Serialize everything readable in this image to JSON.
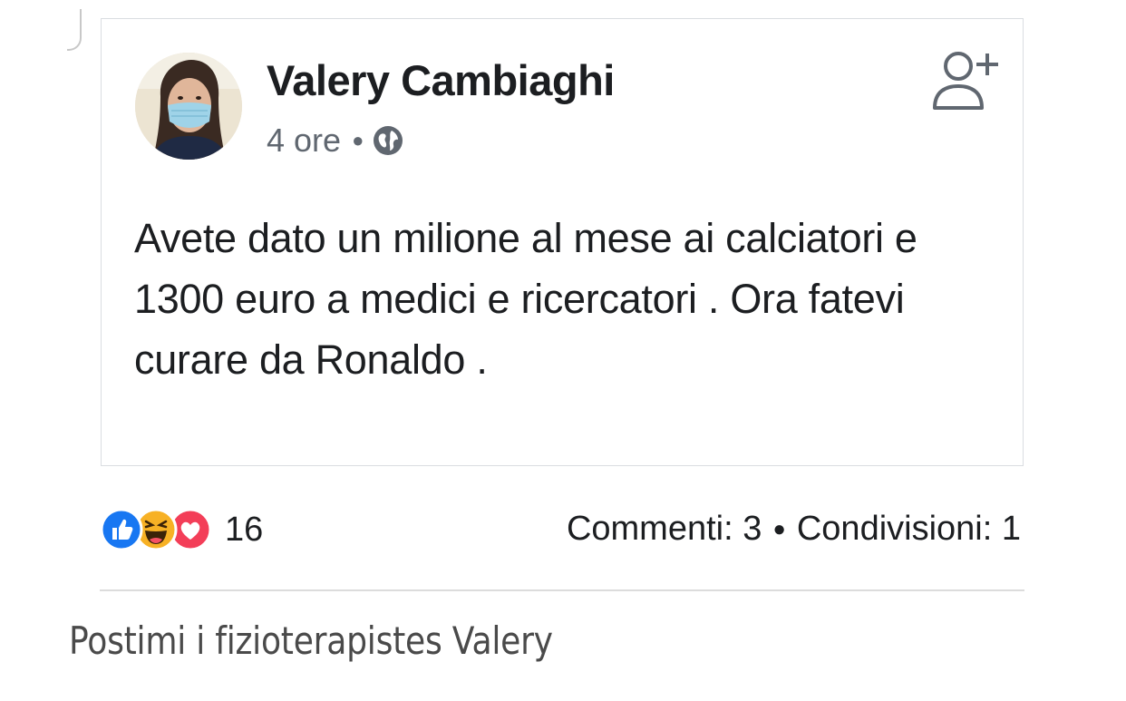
{
  "post": {
    "author": "Valery Cambiaghi",
    "time": "4 ore",
    "privacy_icon": "globe-icon",
    "text": "Avete dato un milione al mese ai calciatori e 1300 euro a medici e ricercatori . Ora fatevi curare da Ronaldo .",
    "add_friend_icon": "add-friend-icon"
  },
  "engagement": {
    "reactions": [
      "like-icon",
      "haha-icon",
      "love-icon"
    ],
    "reaction_count": "16",
    "comments": "Commenti: 3",
    "shares": "Condivisioni: 1"
  },
  "caption": "Postimi i fizioterapistes Valery",
  "colors": {
    "like": "#1877f2",
    "love": "#f33e58",
    "haha": "#f7b125",
    "border": "#dadde1"
  }
}
